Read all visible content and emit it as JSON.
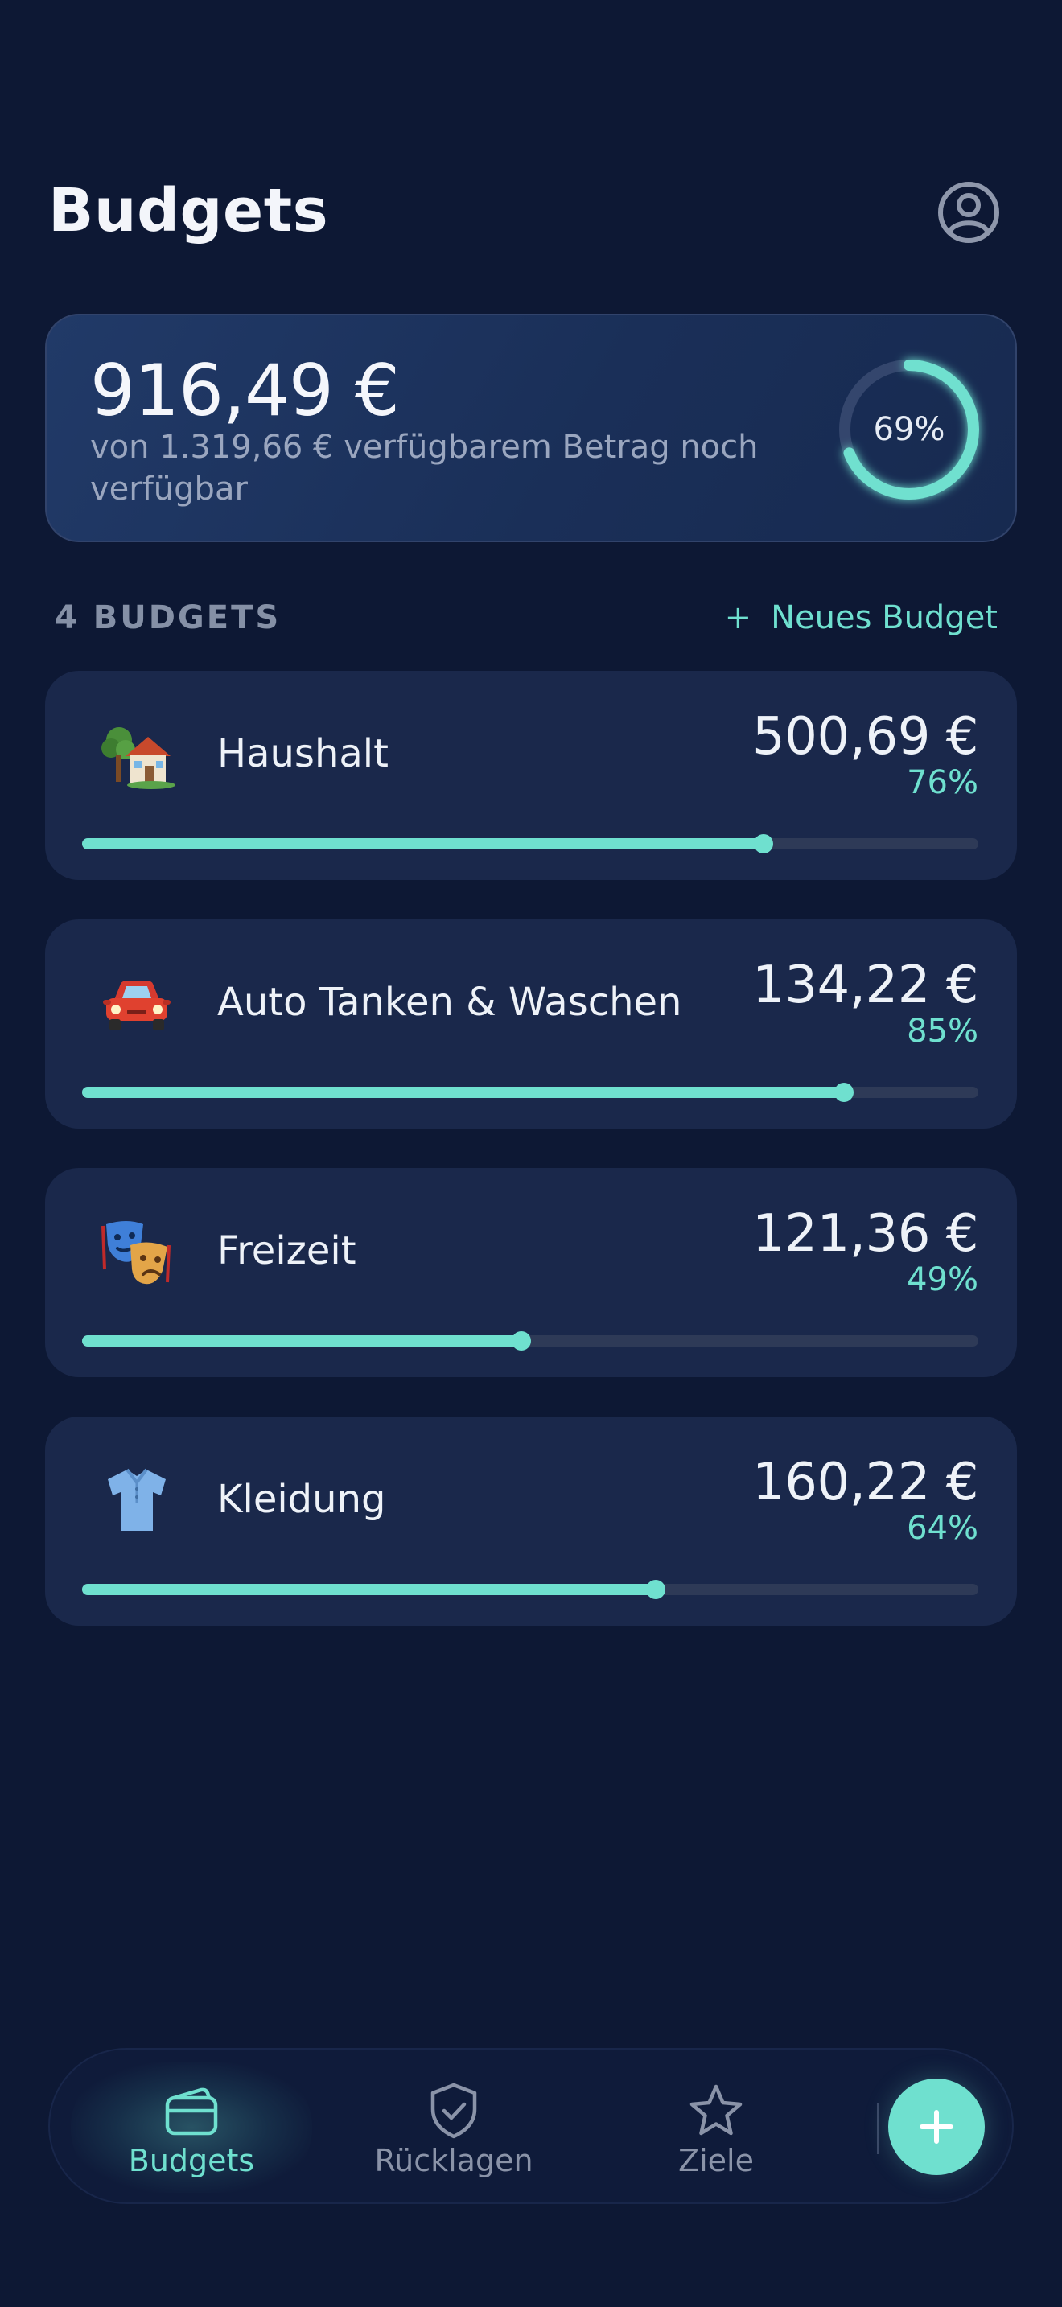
{
  "header": {
    "title": "Budgets",
    "profile_icon": "user-circle-icon"
  },
  "summary": {
    "amount": "916,49 €",
    "subtitle": "von 1.319,66 € verfügbarem Betrag noch verfügbar",
    "percent_label": "69%",
    "percent_value": 69
  },
  "section": {
    "count_label": "4 BUDGETS",
    "new_budget_plus": "+",
    "new_budget_label": "Neues Budget"
  },
  "budgets": [
    {
      "emoji": "house-with-garden-icon",
      "name": "Haushalt",
      "amount": "500,69 €",
      "percent_label": "76%",
      "percent": 76
    },
    {
      "emoji": "car-icon",
      "name": "Auto Tanken & Waschen",
      "amount": "134,22 €",
      "percent_label": "85%",
      "percent": 85
    },
    {
      "emoji": "performing-arts-icon",
      "name": "Freizeit",
      "amount": "121,36 €",
      "percent_label": "49%",
      "percent": 49
    },
    {
      "emoji": "shirt-icon",
      "name": "Kleidung",
      "amount": "160,22 €",
      "percent_label": "64%",
      "percent": 64
    }
  ],
  "tabbar": {
    "tabs": [
      {
        "label": "Budgets",
        "icon": "wallet-icon",
        "active": true
      },
      {
        "label": "Rücklagen",
        "icon": "shield-check-icon",
        "active": false
      },
      {
        "label": "Ziele",
        "icon": "star-icon",
        "active": false
      }
    ],
    "fab_icon": "plus-icon"
  },
  "colors": {
    "background": "#0d1834",
    "card": "#1a284b",
    "accent": "#6fe0cf",
    "muted": "#8a93a8"
  }
}
